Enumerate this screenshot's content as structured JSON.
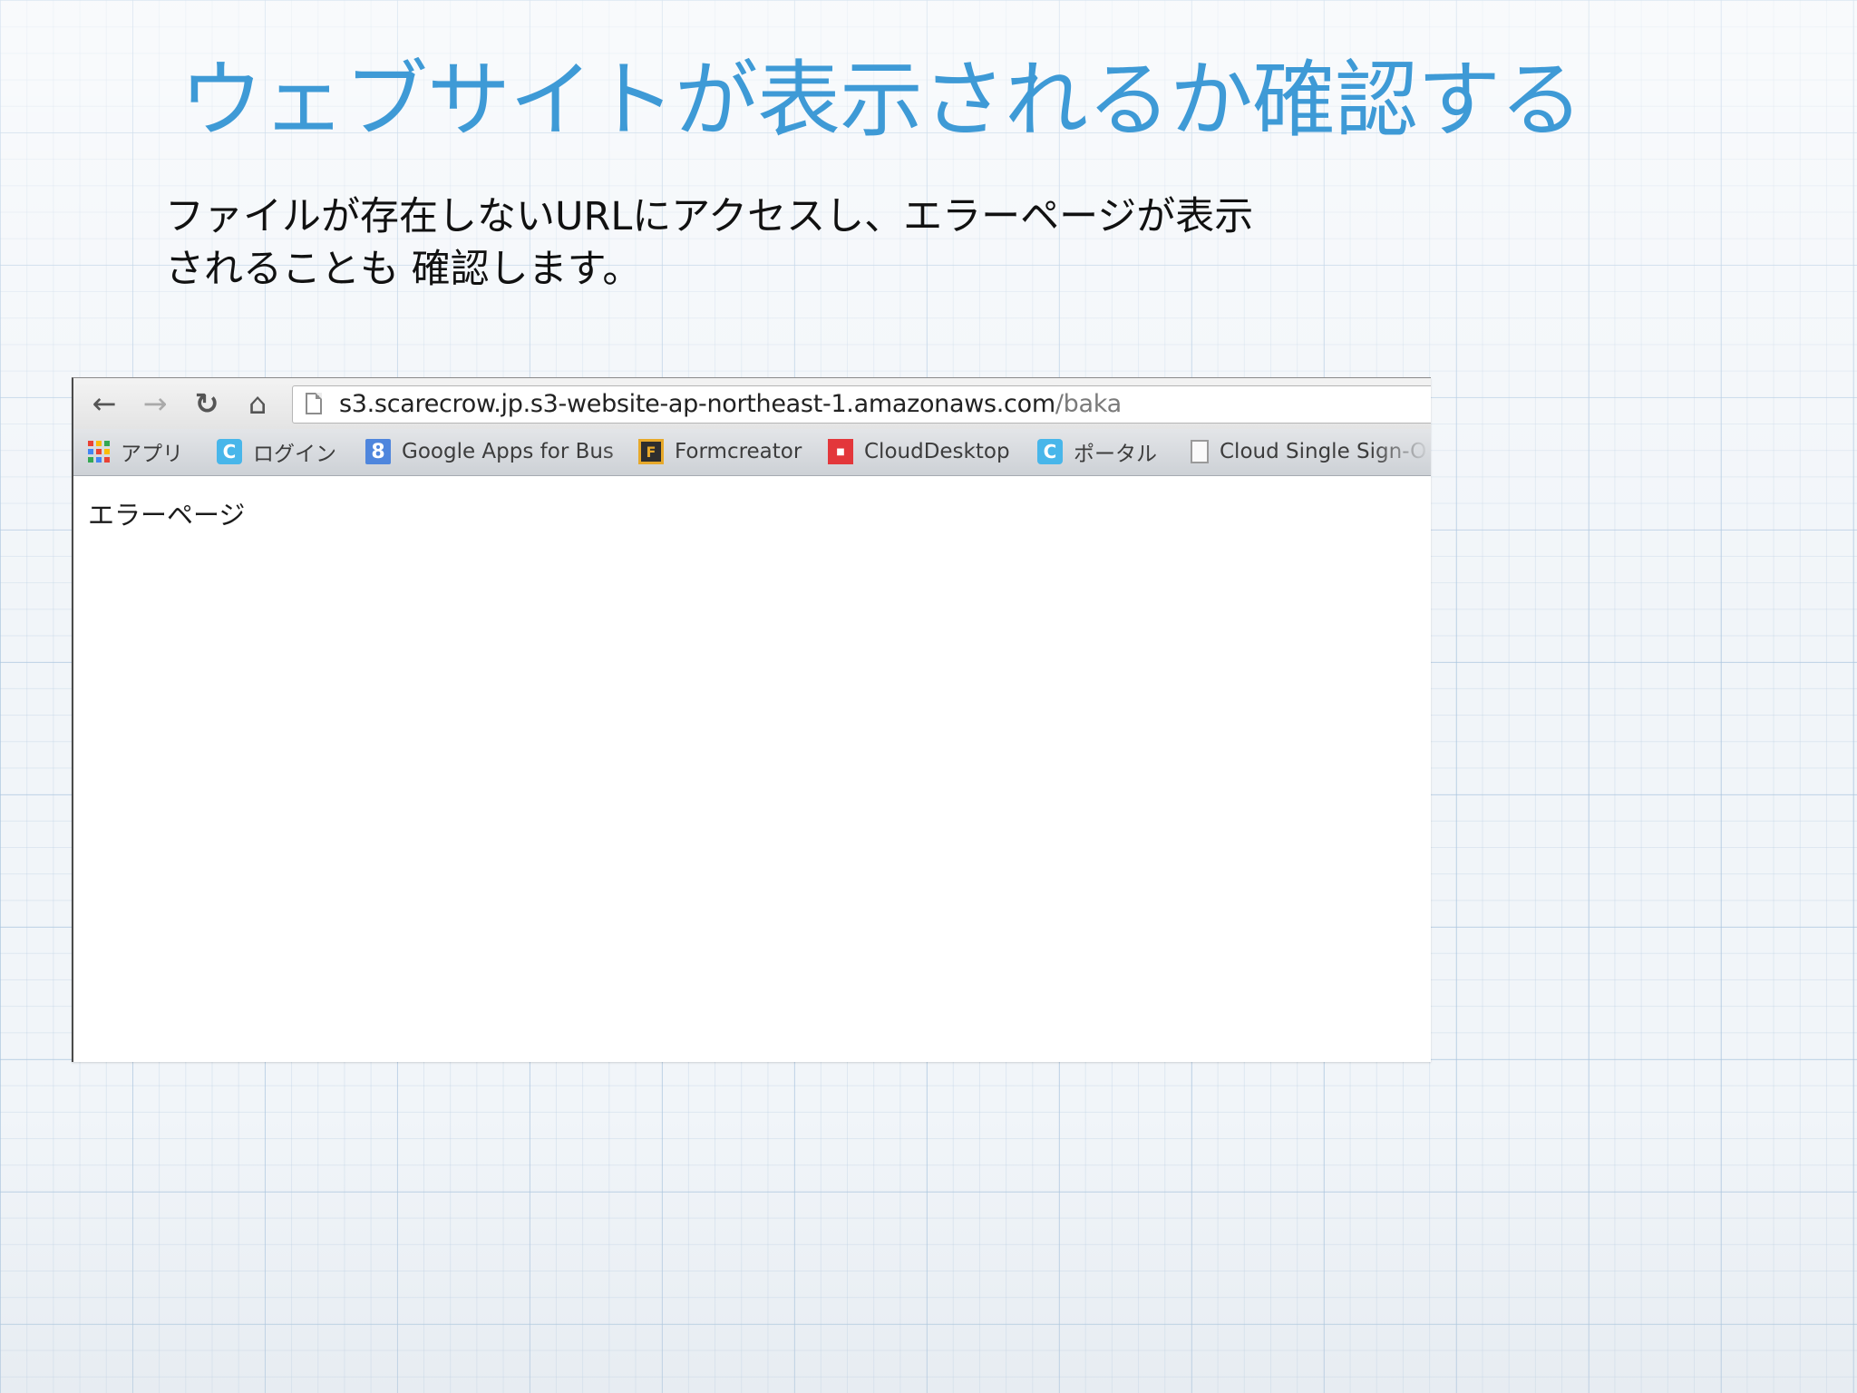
{
  "slide": {
    "title": "ウェブサイトが表示されるか確認する",
    "body_line1": "ファイルが存在しないURLにアクセスし、エラーページが表示",
    "body_line2": "されることも 確認します。"
  },
  "browser": {
    "nav": {
      "back_icon": "←",
      "forward_icon": "→",
      "reload_icon": "↻",
      "home_icon": "⌂"
    },
    "address_bar": {
      "host": "s3.scarecrow.jp.s3-website-ap-northeast-1.amazonaws.com",
      "path": "/baka"
    },
    "bookmarks": [
      {
        "label": "アプリ",
        "icon": "apps-grid-icon"
      },
      {
        "label": "ログイン",
        "icon": "c-logo-icon",
        "glyph": "C"
      },
      {
        "label": "Google Apps for Bus",
        "icon": "google-apps-icon",
        "glyph": "8"
      },
      {
        "label": "Formcreator",
        "icon": "formcreator-icon",
        "glyph": "F"
      },
      {
        "label": "CloudDesktop",
        "icon": "clouddesktop-icon",
        "glyph": "■"
      },
      {
        "label": "ポータル",
        "icon": "c-logo-icon",
        "glyph": "C"
      },
      {
        "label": "Cloud Single Sign-O",
        "icon": "document-icon"
      }
    ],
    "page_content": "エラーページ"
  },
  "colors": {
    "title": "#3e9ad6",
    "grid": "#a8c4de",
    "apps_grid": [
      "#e94235",
      "#fbbc05",
      "#34a853",
      "#4285f4",
      "#e94235",
      "#fbbc05",
      "#34a853",
      "#4285f4",
      "#e94235"
    ]
  }
}
